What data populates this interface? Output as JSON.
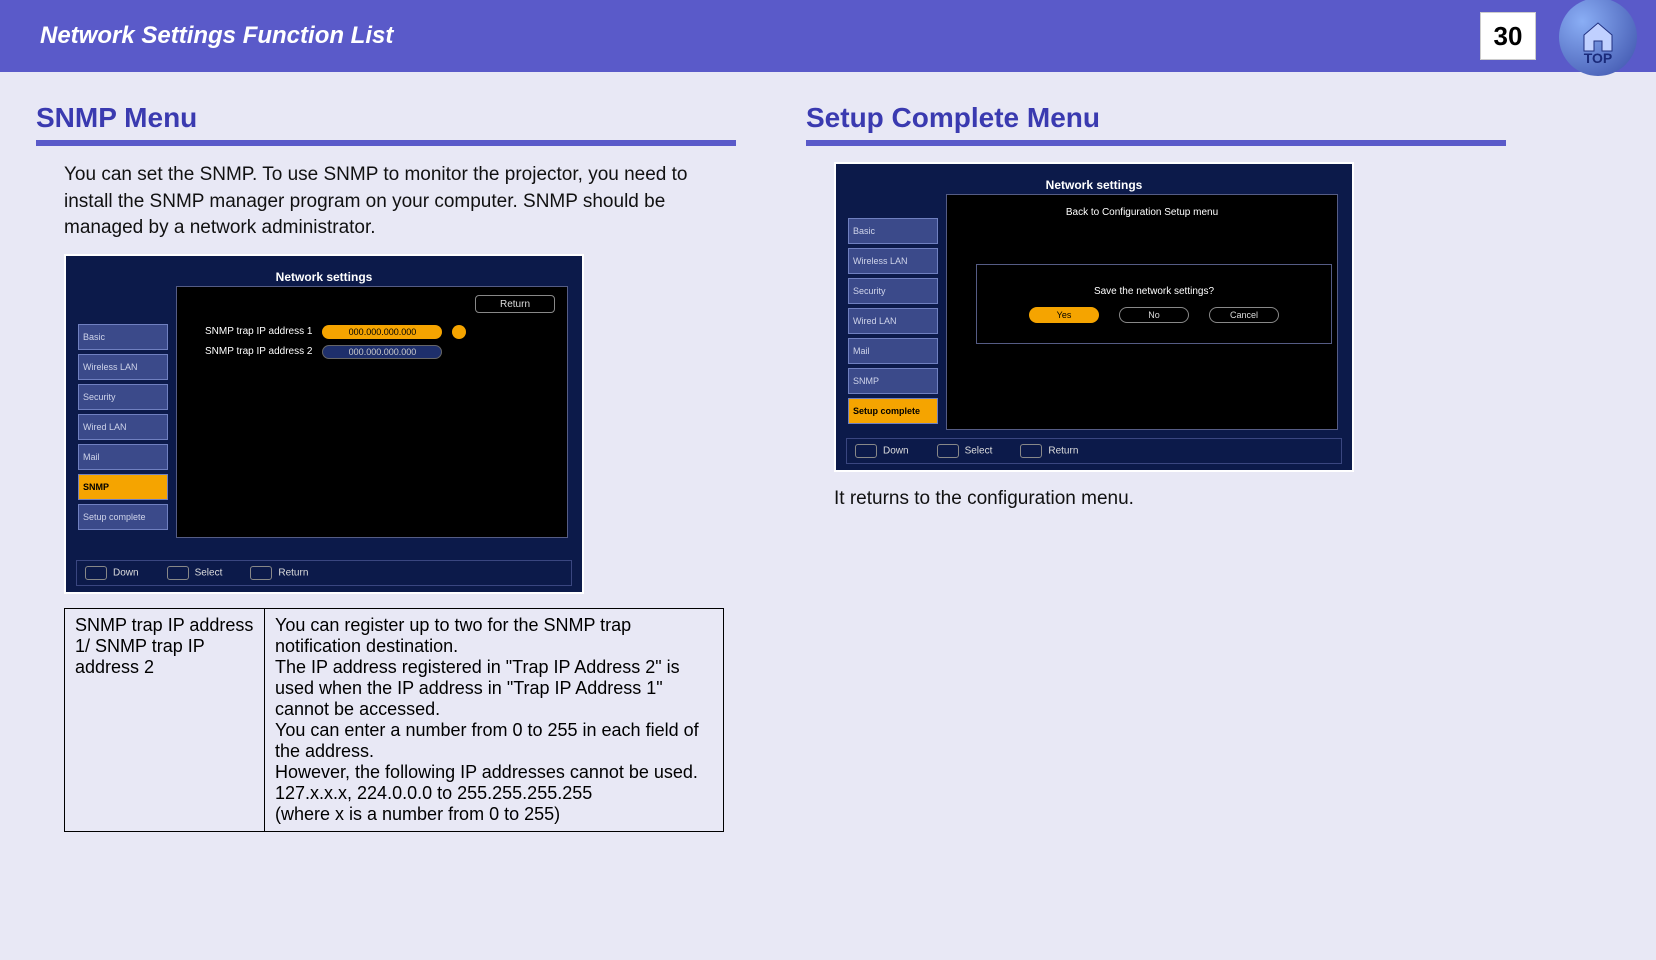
{
  "header": {
    "title": "Network Settings Function List",
    "page_number": "30",
    "top_icon_name": "home-top-icon",
    "top_icon_label": "TOP"
  },
  "left": {
    "heading": "SNMP Menu",
    "intro": "You can set the SNMP. To use SNMP to monitor the projector, you need to install the SNMP manager program on your computer. SNMP should be managed by a network administrator.",
    "screen": {
      "title": "Network settings",
      "return": "Return",
      "tabs": [
        "Basic",
        "Wireless LAN",
        "Security",
        "Wired LAN",
        "Mail",
        "SNMP",
        "Setup complete"
      ],
      "active_tab_index": 5,
      "rows": [
        {
          "label": "SNMP trap IP address 1",
          "value": "000.000.000.000",
          "active": true
        },
        {
          "label": "SNMP trap IP address 2",
          "value": "000.000.000.000",
          "active": false
        }
      ],
      "footer": [
        "Down",
        "Select",
        "Return"
      ]
    },
    "table": {
      "key": "SNMP trap IP address 1/ SNMP trap IP address 2",
      "desc_lines": [
        "You can register up to two for the SNMP trap notification destination.",
        "The IP address registered in \"Trap IP Address 2\" is used when the IP address in \"Trap IP Address 1\" cannot be accessed.",
        "You can enter a number from 0 to 255 in each field of the address.",
        "However, the following IP addresses cannot be used.",
        "127.x.x.x, 224.0.0.0 to 255.255.255.255",
        "(where x is a number from 0 to 255)"
      ]
    }
  },
  "right": {
    "heading": "Setup Complete Menu",
    "screen": {
      "title": "Network settings",
      "subtitle": "Back to Configuration Setup menu",
      "tabs": [
        "Basic",
        "Wireless LAN",
        "Security",
        "Wired LAN",
        "Mail",
        "SNMP",
        "Setup complete"
      ],
      "active_tab_index": 6,
      "dialog": {
        "text": "Save the network settings?",
        "buttons": [
          "Yes",
          "No",
          "Cancel"
        ]
      },
      "footer": [
        "Down",
        "Select",
        "Return"
      ]
    },
    "caption": "It returns to the configuration menu."
  }
}
